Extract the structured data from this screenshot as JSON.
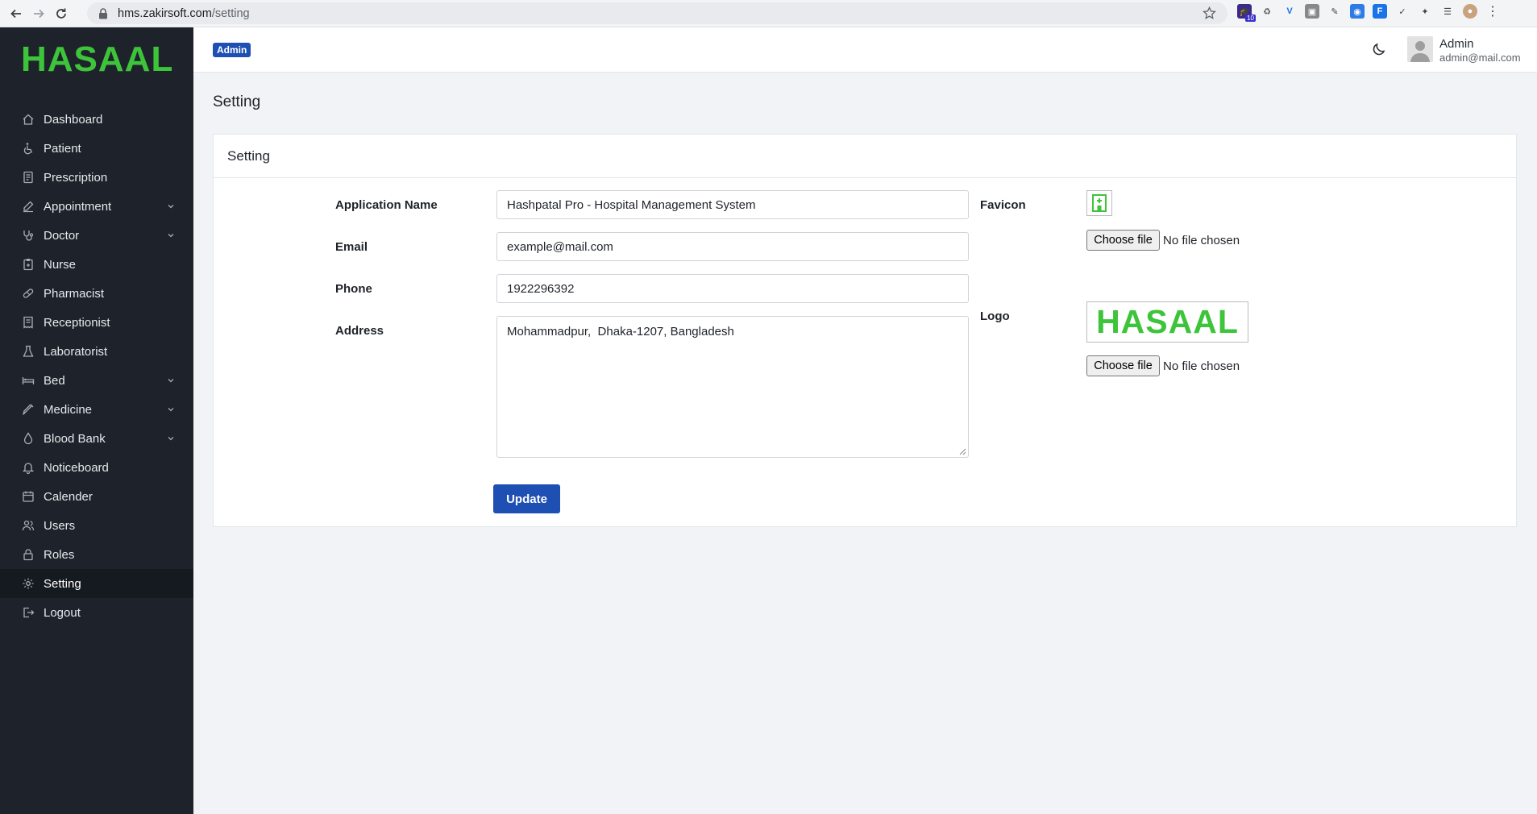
{
  "browser": {
    "url_host": "hms.zakirsoft.com",
    "url_path": "/setting",
    "extension_badge": "10"
  },
  "sidebar": {
    "brand": "HASAAL",
    "items": [
      {
        "label": "Dashboard",
        "icon": "home-icon",
        "has_submenu": false
      },
      {
        "label": "Patient",
        "icon": "wheelchair-icon",
        "has_submenu": false
      },
      {
        "label": "Prescription",
        "icon": "document-icon",
        "has_submenu": false
      },
      {
        "label": "Appointment",
        "icon": "edit-icon",
        "has_submenu": true
      },
      {
        "label": "Doctor",
        "icon": "stethoscope-icon",
        "has_submenu": true
      },
      {
        "label": "Nurse",
        "icon": "clipboard-icon",
        "has_submenu": false
      },
      {
        "label": "Pharmacist",
        "icon": "pill-icon",
        "has_submenu": false
      },
      {
        "label": "Receptionist",
        "icon": "receipt-icon",
        "has_submenu": false
      },
      {
        "label": "Laboratorist",
        "icon": "flask-icon",
        "has_submenu": false
      },
      {
        "label": "Bed",
        "icon": "bed-icon",
        "has_submenu": true
      },
      {
        "label": "Medicine",
        "icon": "syringe-icon",
        "has_submenu": true
      },
      {
        "label": "Blood Bank",
        "icon": "drop-icon",
        "has_submenu": true
      },
      {
        "label": "Noticeboard",
        "icon": "bell-icon",
        "has_submenu": false
      },
      {
        "label": "Calender",
        "icon": "calendar-icon",
        "has_submenu": false
      },
      {
        "label": "Users",
        "icon": "users-icon",
        "has_submenu": false
      },
      {
        "label": "Roles",
        "icon": "lock-icon",
        "has_submenu": false
      },
      {
        "label": "Setting",
        "icon": "gear-icon",
        "has_submenu": false,
        "active": true
      },
      {
        "label": "Logout",
        "icon": "logout-icon",
        "has_submenu": false
      }
    ]
  },
  "header": {
    "role_badge": "Admin",
    "user_name": "Admin",
    "user_email": "admin@mail.com"
  },
  "page": {
    "title": "Setting",
    "card_title": "Setting"
  },
  "form": {
    "app_name_label": "Application Name",
    "app_name_value": "Hashpatal Pro - Hospital Management System",
    "email_label": "Email",
    "email_value": "example@mail.com",
    "phone_label": "Phone",
    "phone_value": "1922296392",
    "address_label": "Address",
    "address_value": "Mohammadpur,  Dhaka-1207, Bangladesh",
    "update_label": "Update",
    "favicon_label": "Favicon",
    "logo_label": "Logo",
    "logo_text": "HASAAL",
    "choose_file_label": "Choose file",
    "no_file_text": "No file chosen"
  },
  "colors": {
    "brand_green": "#3ec43a",
    "primary_blue": "#1e4fb3",
    "sidebar_bg": "#1e232b"
  }
}
